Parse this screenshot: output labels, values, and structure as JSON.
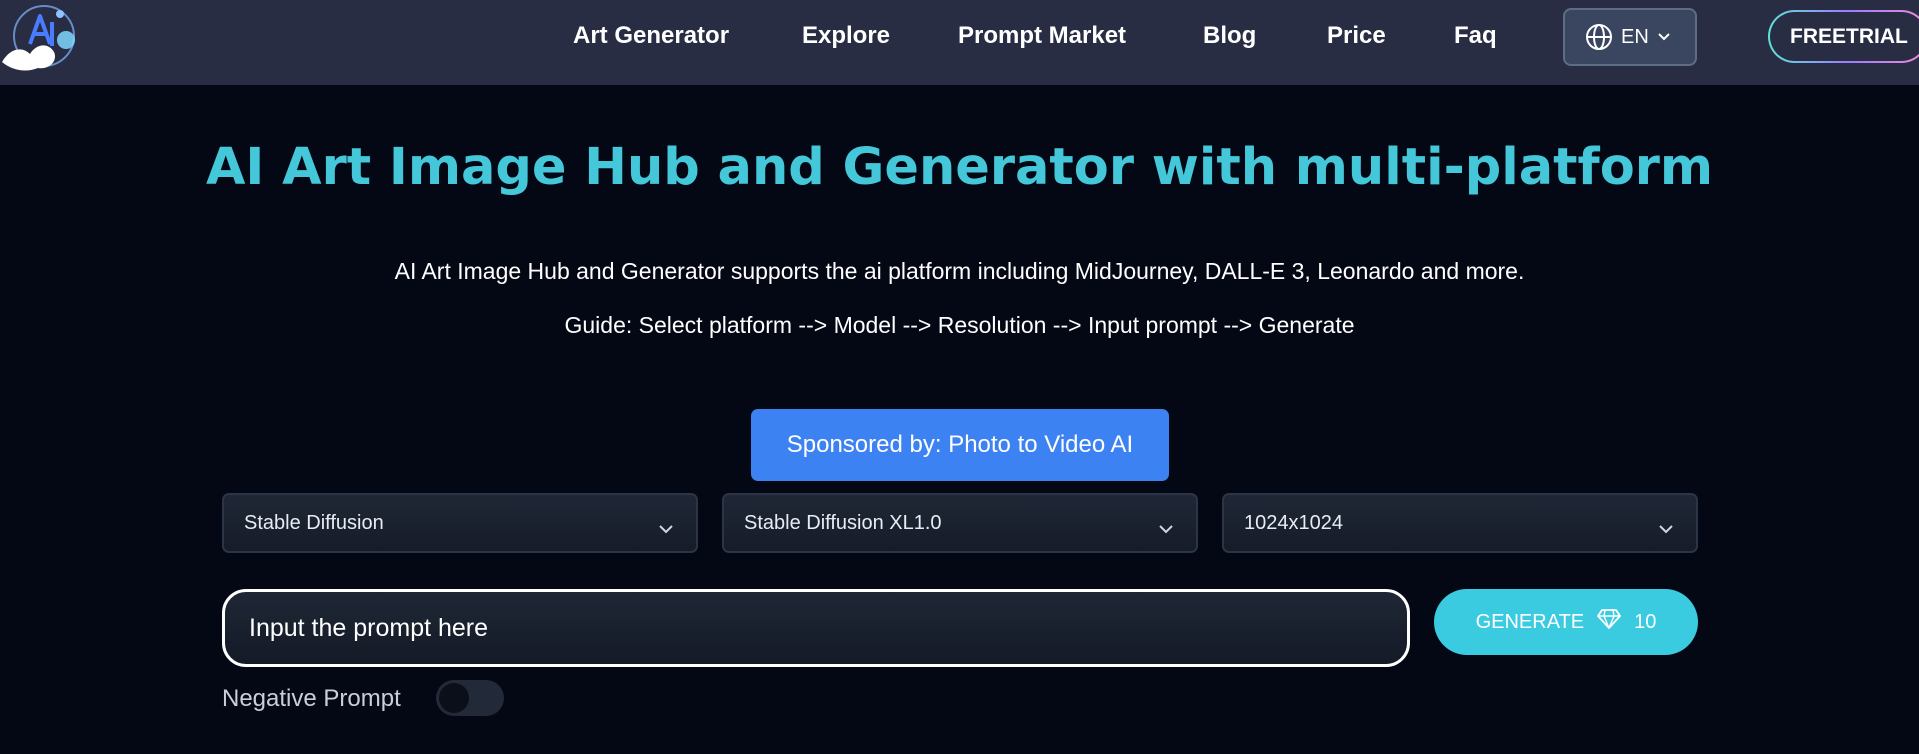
{
  "nav": {
    "links": [
      "Art Generator",
      "Explore",
      "Prompt Market",
      "Blog",
      "Price",
      "Faq"
    ],
    "language": "EN",
    "free_trial": "FREETRIAL"
  },
  "hero": {
    "title": "AI Art Image Hub and Generator with multi-platform",
    "description": "AI Art Image Hub and Generator supports the ai platform including MidJourney, DALL-E 3, Leonardo and more.",
    "guide": "Guide: Select platform --> Model --> Resolution --> Input prompt --> Generate"
  },
  "sponsor": {
    "label": "Sponsored by: Photo to Video AI"
  },
  "selects": {
    "platform": "Stable Diffusion",
    "model": "Stable Diffusion XL1.0",
    "resolution": "1024x1024"
  },
  "prompt": {
    "placeholder": "Input the prompt here"
  },
  "generate": {
    "label": "GENERATE",
    "cost": "10"
  },
  "negative_prompt": {
    "label": "Negative Prompt",
    "enabled": false
  },
  "colors": {
    "title_accent": "#45c7da",
    "sponsor_button": "#3d82f3",
    "generate_button": "#3bcbe1",
    "topbar": "#282d44",
    "background": "#040814"
  },
  "icons": [
    "logo",
    "globe-icon",
    "chevron-down-icon",
    "diamond-icon"
  ]
}
